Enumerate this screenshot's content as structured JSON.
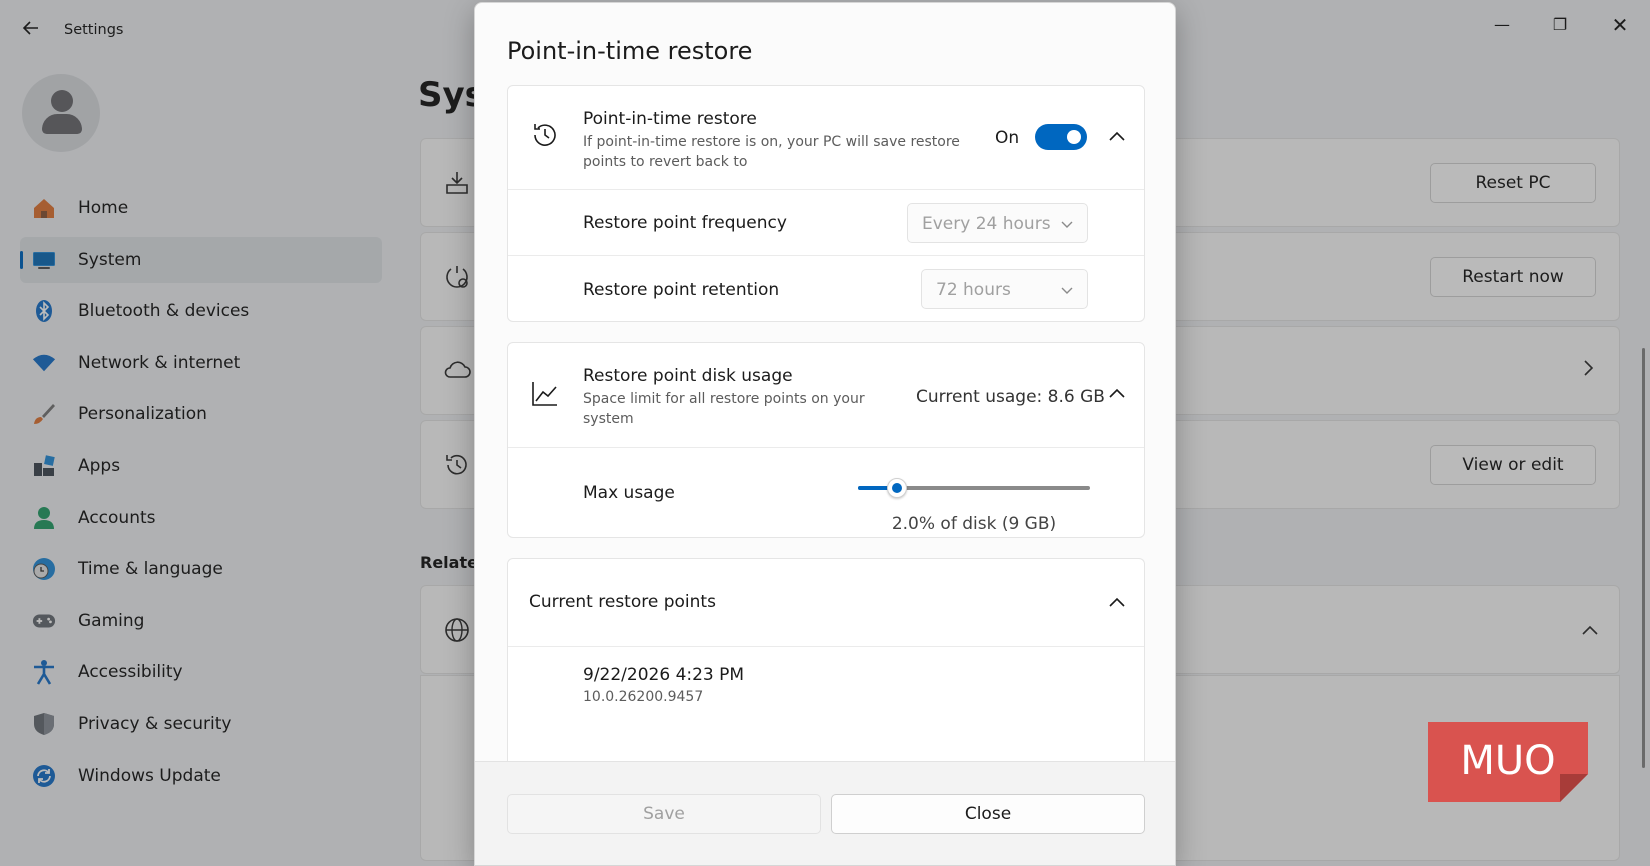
{
  "window": {
    "app_title": "Settings",
    "back_icon": "back-arrow-icon",
    "minimize_glyph": "—",
    "maximize_glyph": "❐",
    "close_glyph": "✕"
  },
  "sidebar": {
    "items": [
      {
        "label": "Home",
        "icon": "home-icon",
        "active": false
      },
      {
        "label": "System",
        "icon": "system-icon",
        "active": true
      },
      {
        "label": "Bluetooth & devices",
        "icon": "bluetooth-icon",
        "active": false
      },
      {
        "label": "Network & internet",
        "icon": "wifi-icon",
        "active": false
      },
      {
        "label": "Personalization",
        "icon": "brush-icon",
        "active": false
      },
      {
        "label": "Apps",
        "icon": "apps-icon",
        "active": false
      },
      {
        "label": "Accounts",
        "icon": "accounts-icon",
        "active": false
      },
      {
        "label": "Time & language",
        "icon": "globe-clock-icon",
        "active": false
      },
      {
        "label": "Gaming",
        "icon": "gamepad-icon",
        "active": false
      },
      {
        "label": "Accessibility",
        "icon": "accessibility-icon",
        "active": false
      },
      {
        "label": "Privacy & security",
        "icon": "shield-icon",
        "active": false
      },
      {
        "label": "Windows Update",
        "icon": "update-icon",
        "active": false
      }
    ]
  },
  "background": {
    "page_heading": "Sys",
    "related_heading": "Related",
    "reset_button": "Reset PC",
    "restart_button": "Restart now",
    "view_edit_button": "View or edit"
  },
  "dialog": {
    "title": "Point-in-time restore",
    "restore": {
      "title": "Point-in-time restore",
      "description": "If point-in-time restore is on, your PC will save restore points to revert back to",
      "toggle_state": "On",
      "toggle_on": true
    },
    "frequency": {
      "label": "Restore point frequency",
      "value": "Every 24 hours"
    },
    "retention": {
      "label": "Restore point retention",
      "value": "72 hours"
    },
    "disk_usage": {
      "title": "Restore point disk usage",
      "description": "Space limit for all restore points on your system",
      "current_usage": "Current usage: 8.6 GB"
    },
    "max_usage": {
      "label": "Max usage",
      "slider_fraction": 0.17,
      "caption": "2.0% of disk (9 GB)"
    },
    "restore_points": {
      "title": "Current restore points",
      "items": [
        {
          "date": "9/22/2026 4:23 PM",
          "build": "10.0.26200.9457"
        }
      ]
    },
    "save_button": "Save",
    "close_button": "Close"
  },
  "watermark": {
    "logo_text": "MUO",
    "color": "#d9534f"
  },
  "colors": {
    "accent": "#0067c0"
  }
}
